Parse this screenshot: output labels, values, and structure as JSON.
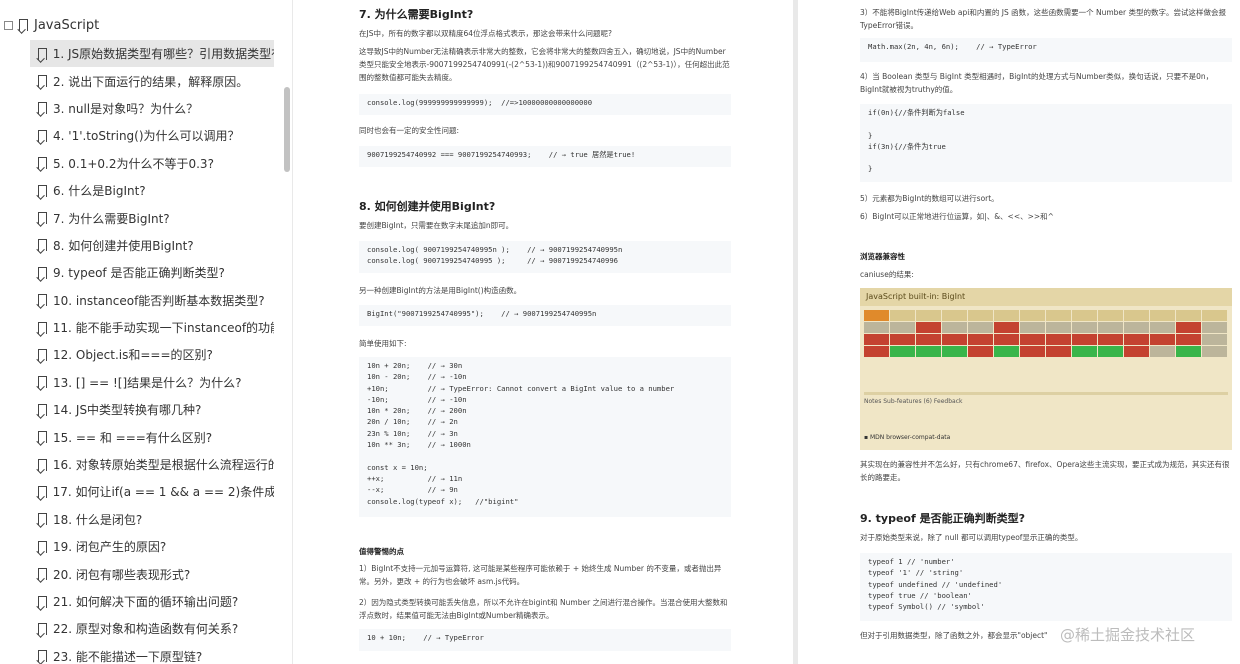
{
  "sidebar": {
    "root_label": "JavaScript",
    "items": [
      "1. JS原始数据类型有哪些？引用数据类型有",
      "2. 说出下面运行的结果，解释原因。",
      "3. null是对象吗？为什么？",
      "4. '1'.toString()为什么可以调用？",
      "5. 0.1+0.2为什么不等于0.3?",
      "6. 什么是BigInt?",
      "7. 为什么需要BigInt?",
      "8. 如何创建并使用BigInt?",
      "9. typeof 是否能正确判断类型?",
      "10. instanceof能否判断基本数据类型?",
      "11. 能不能手动实现一下instanceof的功能",
      "12. Object.is和===的区别?",
      "13. [] == ![]结果是什么？为什么?",
      "14. JS中类型转换有哪几种?",
      "15. == 和 ===有什么区别?",
      "16. 对象转原始类型是根据什么流程运行的",
      "17. 如何让if(a == 1 && a == 2)条件成立",
      "18. 什么是闭包?",
      "19. 闭包产生的原因?",
      "20. 闭包有哪些表现形式?",
      "21. 如何解决下面的循环输出问题?",
      "22. 原型对象和构造函数有何关系?",
      "23. 能不能描述一下原型链?"
    ]
  },
  "left_page": {
    "h7": "7. 为什么需要BigInt?",
    "p1": "在JS中，所有的数字都以双精度64位浮点格式表示，那这会带来什么问题呢?",
    "p2": "这导致JS中的Number无法精确表示非常大的整数，它会将非常大的整数四舍五入，确切地说，JS中的Number类型只能安全地表示-9007199254740991(-(2^53-1))和9007199254740991（(2^53-1)），任何超出此范围的整数值都可能失去精度。",
    "code1": "console.log(999999999999999);  //=>10000000000000000",
    "p3": "同时也会有一定的安全性问题:",
    "code2": "9007199254740992 === 9007199254740993;    // → true 居然是true!",
    "h8": "8. 如何创建并使用BigInt?",
    "p4": "要创建BigInt，只需要在数字末尾追加n即可。",
    "code3a": "console.log( 9007199254740995n );    // → 9007199254740995n",
    "code3b": "console.log( 9007199254740995 );     // → 9007199254740996",
    "p5": "另一种创建BigInt的方法是用BigInt()构造函数。",
    "code4": "BigInt(\"9007199254740995\");    // → 9007199254740995n",
    "p6": "简单使用如下:",
    "code5": [
      "10n + 20n;    // → 30n",
      "10n - 20n;    // → -10n",
      "+10n;         // → TypeError: Cannot convert a BigInt value to a number",
      "-10n;         // → -10n",
      "10n * 20n;    // → 200n",
      "20n / 10n;    // → 2n",
      "23n % 10n;    // → 3n",
      "10n ** 3n;    // → 1000n",
      "",
      "const x = 10n;",
      "++x;          // → 11n",
      "--x;          // → 9n",
      "console.log(typeof x);   //\"bigint\""
    ],
    "sh1": "值得警惕的点",
    "p7": "1）BigInt不支持一元加号运算符, 这可能是某些程序可能依赖于 + 始终生成 Number 的不变量，或者抛出异常。另外，更改 + 的行为也会破坏 asm.js代码。",
    "p8": "2）因为隐式类型转换可能丢失信息，所以不允许在bigint和 Number 之间进行混合操作。当混合使用大整数和浮点数时，结果值可能无法由BigInt或Number精确表示。",
    "code6": "10 + 10n;    // → TypeError"
  },
  "right_page": {
    "p1": "3）不能将BigInt传递给Web api和内置的 JS 函数，这些函数需要一个 Number 类型的数字。尝试这样做会报TypeError错误。",
    "code1": "Math.max(2n, 4n, 6n);    // → TypeError",
    "p2": "4）当 Boolean 类型与 BigInt 类型相遇时，BigInt的处理方式与Number类似，换句话说，只要不是0n，BigInt就被视为truthy的值。",
    "code2": [
      "if(0n){//条件判断为false",
      "",
      "}",
      "if(3n){//条件为true",
      "",
      "}"
    ],
    "p3": "5）元素都为BigInt的数组可以进行sort。",
    "p4": "6）BigInt可以正常地进行位运算，如|、&、<<、>>和^",
    "sh1": "浏览器兼容性",
    "p5": "caniuse的结果:",
    "caniuse_title": "JavaScript built-in: BigInt",
    "caniuse_tabs": "Notes   Sub-features (6)   Feedback",
    "caniuse_foot": "MDN browser-compat-data",
    "p6": "其实现在的兼容性并不怎么好，只有chrome67、firefox、Opera这些主流实现，要正式成为规范，其实还有很长的路要走。",
    "h9": "9. typeof 是否能正确判断类型?",
    "p7": "对于原始类型来说，除了 null 都可以调用typeof显示正确的类型。",
    "code3": [
      "typeof 1 // 'number'",
      "typeof '1' // 'string'",
      "typeof undefined // 'undefined'",
      "typeof true // 'boolean'",
      "typeof Symbol() // 'symbol'"
    ],
    "p8": "但对于引用数据类型，除了函数之外，都会显示\"object\""
  },
  "watermark": "@稀土掘金技术社区"
}
